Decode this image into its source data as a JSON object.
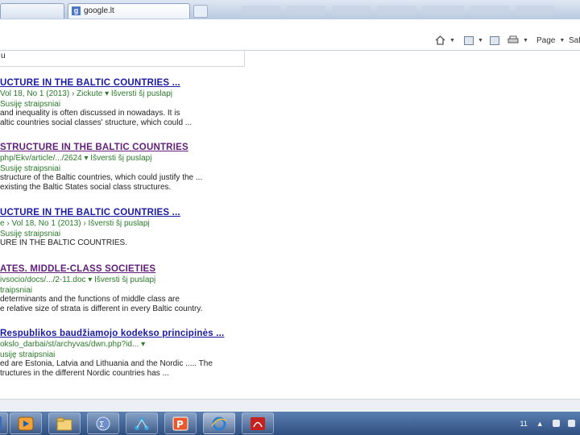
{
  "tabs": [
    {
      "label": ""
    },
    {
      "label": "google.lt",
      "favicon": "google-favicon"
    }
  ],
  "toolbar": {
    "items": [
      {
        "icon": "home-icon"
      },
      {
        "icon": "feeds-icon"
      },
      {
        "icon": "mail-icon"
      },
      {
        "icon": "print-icon"
      },
      {
        "label": "Page",
        "icon": "page-icon"
      },
      {
        "label": "Safe",
        "icon": "safety-icon"
      }
    ]
  },
  "search": {
    "value": "u"
  },
  "results": [
    {
      "title": "UCTURE IN THE BALTIC COUNTRIES ...",
      "url": "Vol 18, No 1 (2013) › Zickute ▾ Išversti šį puslapį",
      "meta": "Susiję straipsniai",
      "snippet": [
        "and inequality is often discussed in nowadays. It is",
        "altic countries social classes' structure, which could ..."
      ],
      "visited": false
    },
    {
      "title": "STRUCTURE IN THE BALTIC COUNTRIES",
      "url": "php/Ekv/article/.../2624 ▾ Išversti šį puslapį",
      "meta": "Susiję straipsniai",
      "snippet": [
        "structure of the Baltic countries, which could justify the ...",
        "existing the Baltic States social class structures."
      ],
      "visited": true
    },
    {
      "title": "UCTURE IN THE BALTIC COUNTRIES ...",
      "url": "e › Vol 18, No 1 (2013) › Išversti šį puslapį",
      "meta": "Susiję straipsniai",
      "snippet": [
        "URE IN THE BALTIC COUNTRIES."
      ],
      "visited": false
    },
    {
      "title": "ATES. MIDDLE-CLASS SOCIETIES",
      "url": "ivsocio/docs/.../2-11.doc ▾ Išversti šį puslapį",
      "meta": "traipsniai",
      "snippet": [
        "determinants and the functions of middle class are",
        "e relative size of strata is different in every Baltic country."
      ],
      "visited": true
    },
    {
      "title": "Respublikos baudžiamojo kodekso principinės ...",
      "url": "okslo_darbai/st/archyvas/dwn.php?id... ▾",
      "meta": "usiję straipsniai",
      "snippet": [
        "ed are Estonia, Latvia and Lithuania and the Nordic ..... The",
        "tructures in the different Nordic countries has ..."
      ],
      "visited": false
    }
  ],
  "taskbar": {
    "buttons": [
      {
        "icon": "windows-start-icon"
      },
      {
        "icon": "media-player-icon"
      },
      {
        "icon": "file-explorer-icon"
      },
      {
        "icon": "math-input-icon"
      },
      {
        "icon": "network-icon"
      },
      {
        "icon": "powerpoint-icon"
      },
      {
        "icon": "internet-explorer-icon"
      },
      {
        "icon": "acrobat-reader-icon"
      }
    ],
    "tray_text": "11"
  }
}
